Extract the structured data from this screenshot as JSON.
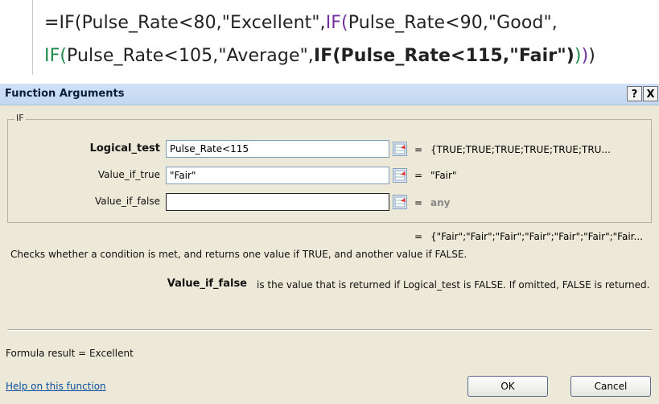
{
  "formula": {
    "line1": [
      {
        "t": "=IF(",
        "c": "blk"
      },
      {
        "t": "Pulse_Rate<80,\"Excellent\",",
        "c": "blk"
      },
      {
        "t": "IF(",
        "c": "purple"
      },
      {
        "t": "Pulse_Rate<90,\"Good\",",
        "c": "blk"
      }
    ],
    "line2": [
      {
        "t": "IF(",
        "c": "green"
      },
      {
        "t": "Pulse_Rate<105,\"Average\",",
        "c": "blk"
      },
      {
        "t": "IF(Pulse_Rate<115,\"Fair\")",
        "c": "bold"
      },
      {
        "t": ")",
        "c": "green"
      },
      {
        "t": ")",
        "c": "purple"
      },
      {
        "t": ")",
        "c": "blk"
      }
    ]
  },
  "dialog": {
    "title": "Function Arguments",
    "help_btn": "?",
    "close_btn": "X",
    "function_name": "IF",
    "args": [
      {
        "label": "Logical_test",
        "value": "Pulse_Rate<115",
        "eq": "=",
        "result": "{TRUE;TRUE;TRUE;TRUE;TRUE;TRU..."
      },
      {
        "label": "Value_if_true",
        "value": "\"Fair\"",
        "eq": "=",
        "result": "\"Fair\""
      },
      {
        "label": "Value_if_false",
        "value": "",
        "eq": "=",
        "result": "any"
      }
    ],
    "overall_eq": "=",
    "overall_result": "{\"Fair\";\"Fair\";\"Fair\";\"Fair\";\"Fair\";\"Fair\";\"Fair...",
    "description": "Checks whether a condition is met, and returns one value if TRUE, and another value if FALSE.",
    "arg_help_name": "Value_if_false",
    "arg_help_text": "is the value that is returned if Logical_test is FALSE. If omitted, FALSE is returned.",
    "formula_result": "Formula result =   Excellent",
    "help_link": "Help on this function",
    "ok": "OK",
    "cancel": "Cancel"
  }
}
